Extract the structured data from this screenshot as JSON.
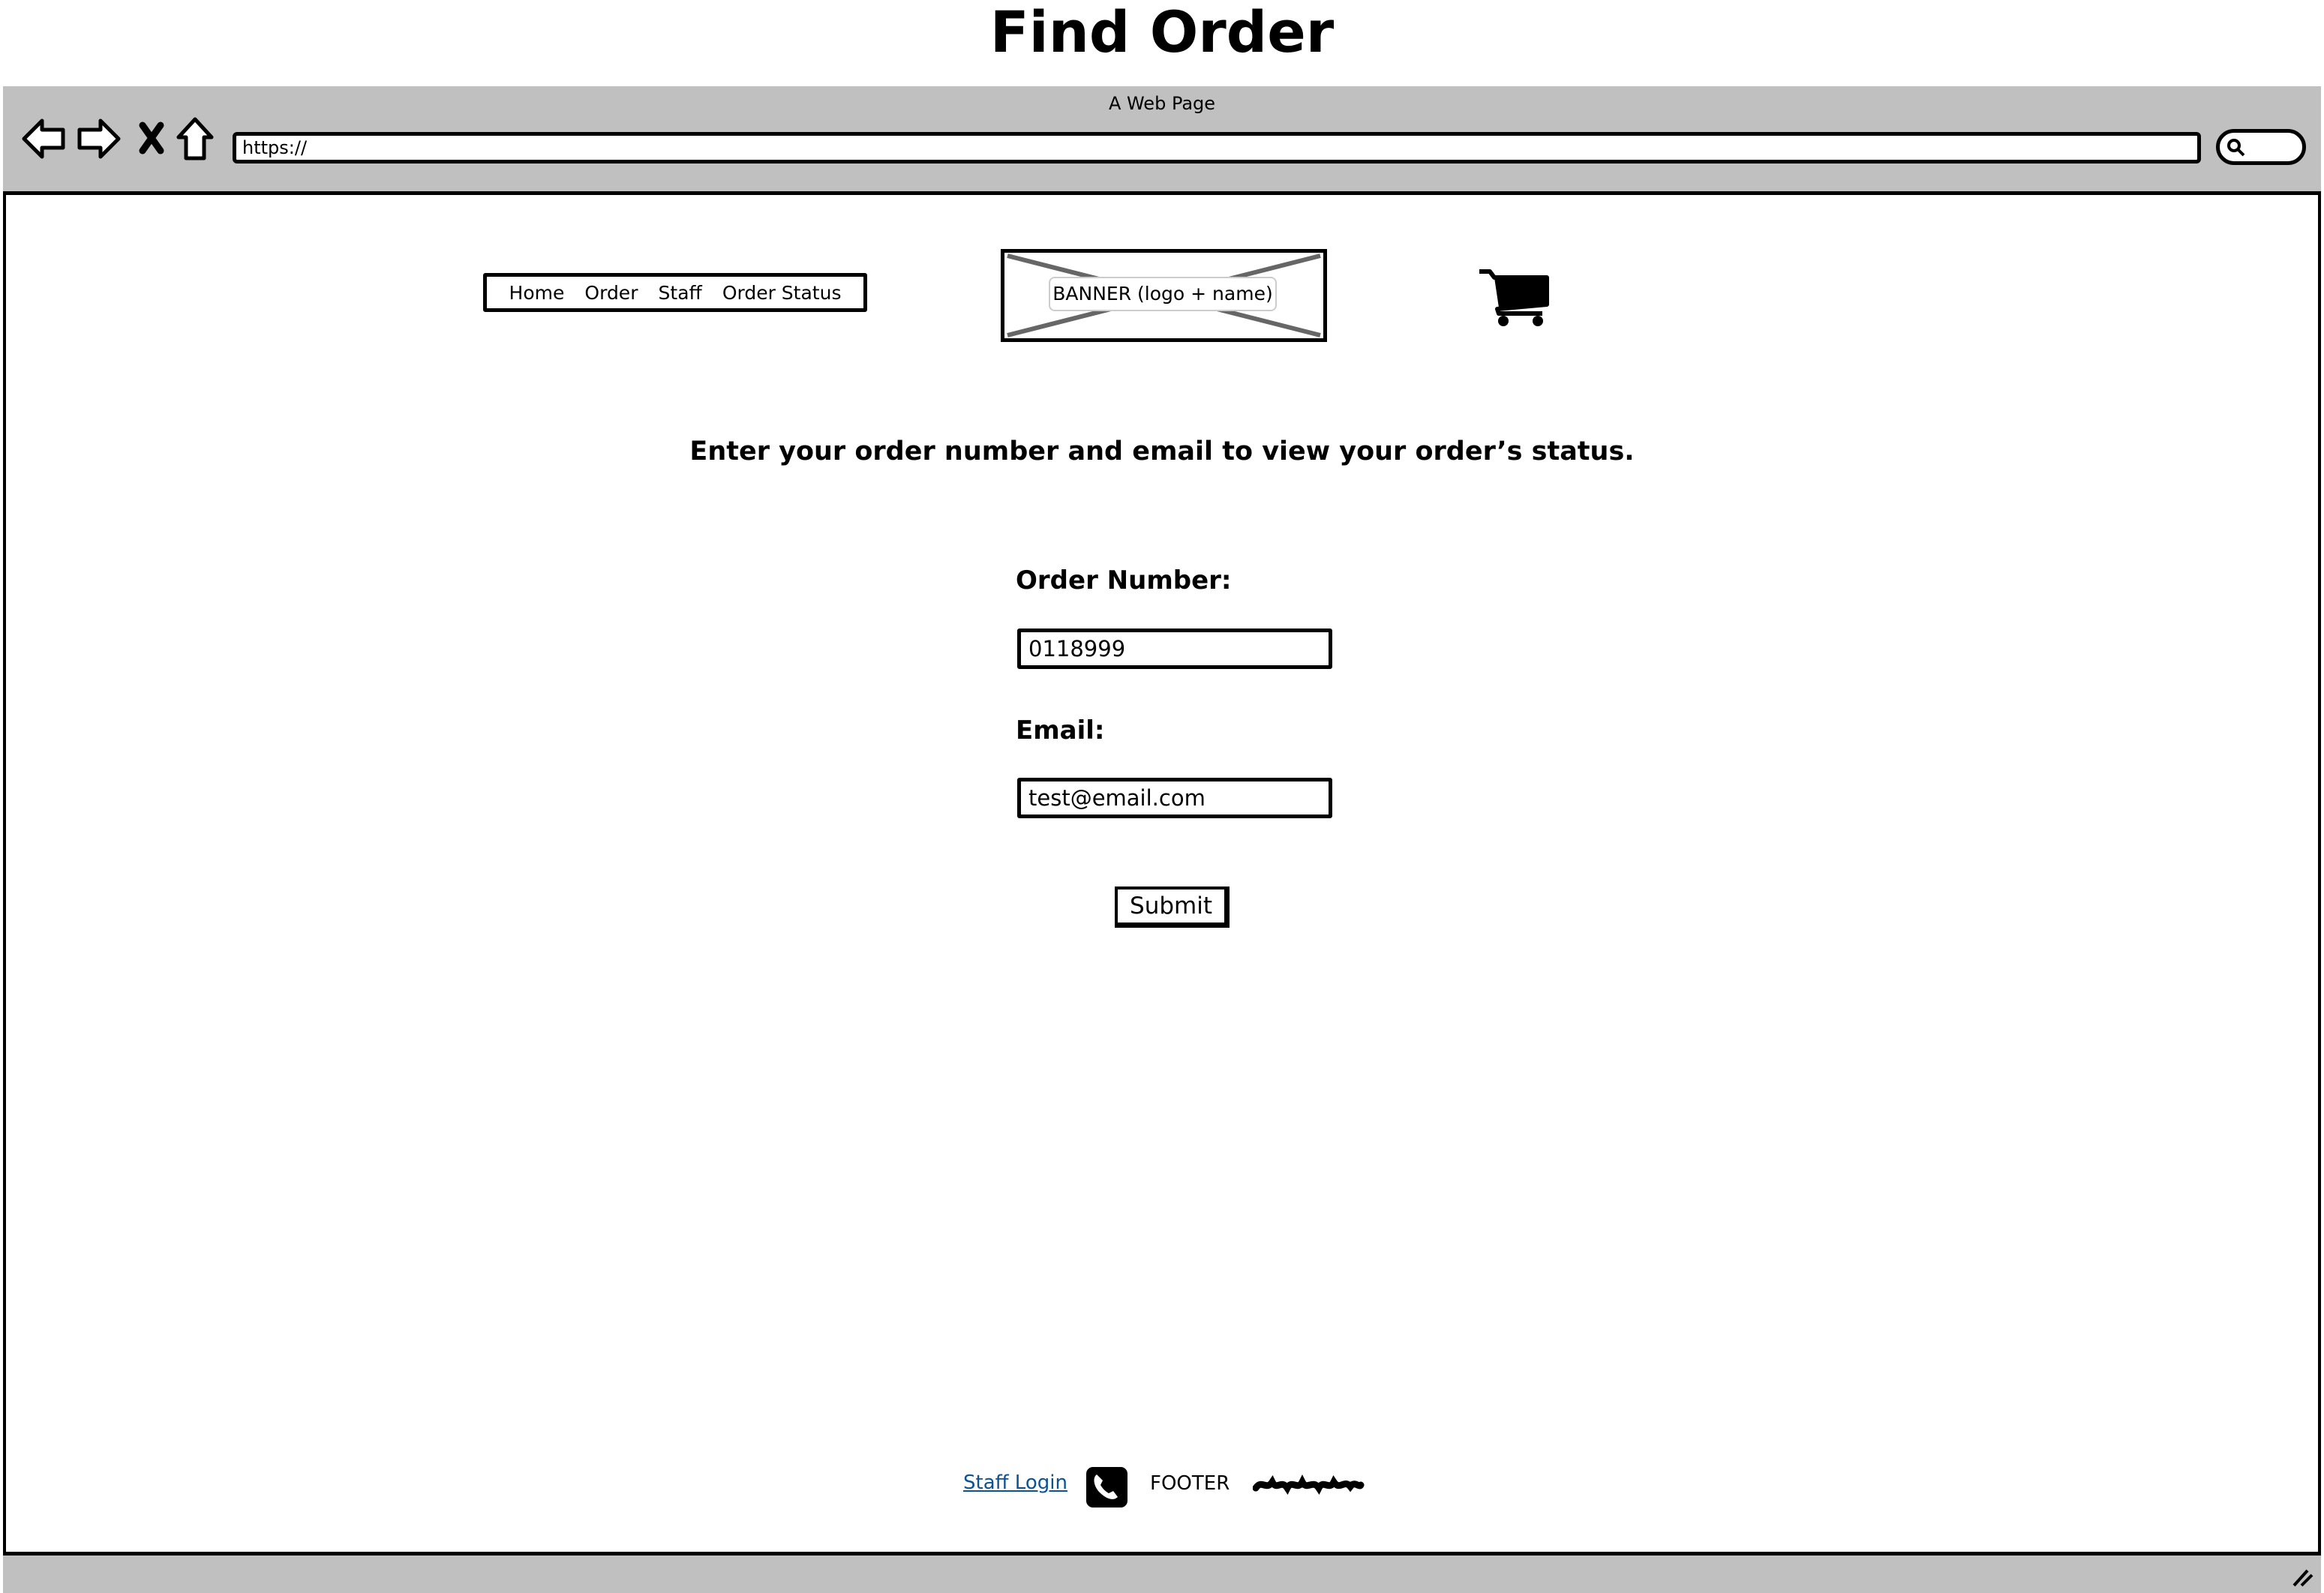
{
  "page_title": "Find Order",
  "browser": {
    "window_title": "A Web Page",
    "url": "https://"
  },
  "nav": {
    "items": [
      {
        "label": "Home"
      },
      {
        "label": "Order"
      },
      {
        "label": "Staff"
      },
      {
        "label": "Order Status"
      }
    ]
  },
  "banner": {
    "label": "BANNER (logo + name)"
  },
  "cart": {
    "icon": "shopping-cart-icon"
  },
  "main": {
    "heading": "Enter your order number and email to view your order’s status.",
    "order_number_label": "Order Number:",
    "order_number_value": "0118999",
    "email_label": "Email:",
    "email_value": "test@email.com",
    "submit_label": "Submit"
  },
  "footer": {
    "staff_login": "Staff Login",
    "phone_icon": "phone-icon",
    "text": "FOOTER",
    "link_color": "#0b5394"
  }
}
